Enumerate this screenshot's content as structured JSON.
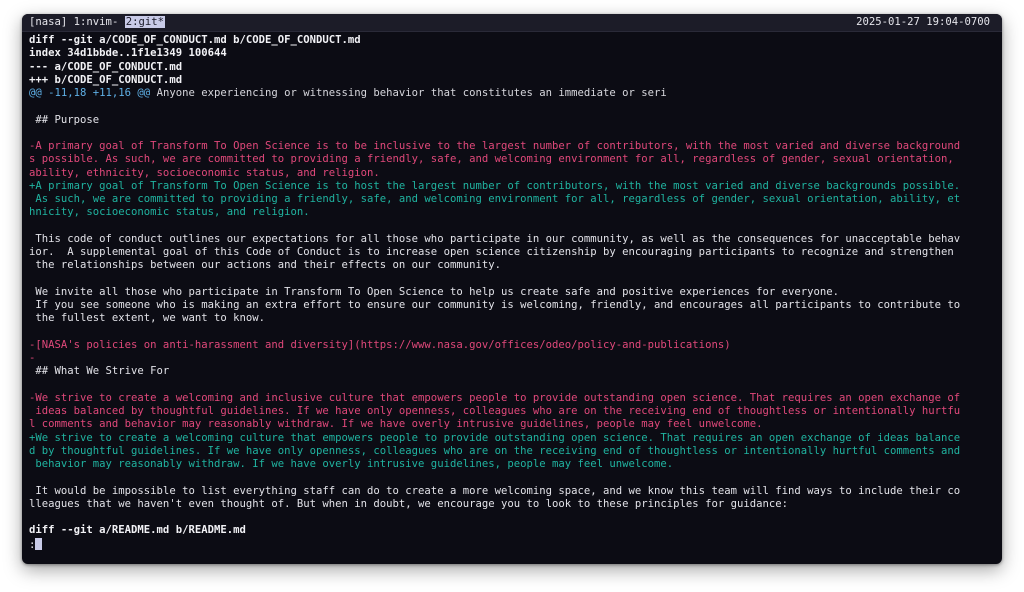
{
  "statusbar": {
    "session": "[nasa]",
    "window1": "1:nvim-",
    "window2": "2:git*",
    "datetime": "2025-01-27 19:04-0700"
  },
  "diff": {
    "lines": [
      {
        "type": "meta",
        "text": "diff --git a/CODE_OF_CONDUCT.md b/CODE_OF_CONDUCT.md"
      },
      {
        "type": "meta",
        "text": "index 34d1bbde..1f1e1349 100644"
      },
      {
        "type": "meta",
        "text": "--- a/CODE_OF_CONDUCT.md"
      },
      {
        "type": "meta",
        "text": "+++ b/CODE_OF_CONDUCT.md"
      },
      {
        "type": "hunk",
        "text": "@@ -11,18 +11,16 @@",
        "rest": " Anyone experiencing or witnessing behavior that constitutes an immediate or seri"
      },
      {
        "type": "ctx",
        "text": ""
      },
      {
        "type": "ctx",
        "text": " ## Purpose"
      },
      {
        "type": "ctx",
        "text": ""
      },
      {
        "type": "del",
        "text": "-A primary goal of Transform To Open Science is to be inclusive to the largest number of contributors, with the most varied and diverse background"
      },
      {
        "type": "del",
        "text": "s possible. As such, we are committed to providing a friendly, safe, and welcoming environment for all, regardless of gender, sexual orientation,"
      },
      {
        "type": "del",
        "text": "ability, ethnicity, socioeconomic status, and religion."
      },
      {
        "type": "add",
        "text": "+A primary goal of Transform To Open Science is to host the largest number of contributors, with the most varied and diverse backgrounds possible."
      },
      {
        "type": "add",
        "text": " As such, we are committed to providing a friendly, safe, and welcoming environment for all, regardless of gender, sexual orientation, ability, et"
      },
      {
        "type": "add",
        "text": "hnicity, socioeconomic status, and religion."
      },
      {
        "type": "ctx",
        "text": ""
      },
      {
        "type": "ctx",
        "text": " This code of conduct outlines our expectations for all those who participate in our community, as well as the consequences for unacceptable behav"
      },
      {
        "type": "ctx",
        "text": "ior.  A supplemental goal of this Code of Conduct is to increase open science citizenship by encouraging participants to recognize and strengthen"
      },
      {
        "type": "ctx",
        "text": " the relationships between our actions and their effects on our community."
      },
      {
        "type": "ctx",
        "text": ""
      },
      {
        "type": "ctx",
        "text": " We invite all those who participate in Transform To Open Science to help us create safe and positive experiences for everyone."
      },
      {
        "type": "ctx",
        "text": " If you see someone who is making an extra effort to ensure our community is welcoming, friendly, and encourages all participants to contribute to"
      },
      {
        "type": "ctx",
        "text": " the fullest extent, we want to know."
      },
      {
        "type": "ctx",
        "text": ""
      },
      {
        "type": "del",
        "text": "-[NASA's policies on anti-harassment and diversity](https://www.nasa.gov/offices/odeo/policy-and-publications)"
      },
      {
        "type": "del",
        "text": "-"
      },
      {
        "type": "ctx",
        "text": " ## What We Strive For"
      },
      {
        "type": "ctx",
        "text": ""
      },
      {
        "type": "del",
        "text": "-We strive to create a welcoming and inclusive culture that empowers people to provide outstanding open science. That requires an open exchange of"
      },
      {
        "type": "del",
        "text": " ideas balanced by thoughtful guidelines. If we have only openness, colleagues who are on the receiving end of thoughtless or intentionally hurtfu"
      },
      {
        "type": "del",
        "text": "l comments and behavior may reasonably withdraw. If we have overly intrusive guidelines, people may feel unwelcome."
      },
      {
        "type": "add",
        "text": "+We strive to create a welcoming culture that empowers people to provide outstanding open science. That requires an open exchange of ideas balance"
      },
      {
        "type": "add",
        "text": "d by thoughtful guidelines. If we have only openness, colleagues who are on the receiving end of thoughtless or intentionally hurtful comments and"
      },
      {
        "type": "add",
        "text": " behavior may reasonably withdraw. If we have overly intrusive guidelines, people may feel unwelcome."
      },
      {
        "type": "ctx",
        "text": ""
      },
      {
        "type": "ctx",
        "text": " It would be impossible to list everything staff can do to create a more welcoming space, and we know this team will find ways to include their co"
      },
      {
        "type": "ctx",
        "text": "lleagues that we haven't even thought of. But when in doubt, we encourage you to look to these principles for guidance:"
      },
      {
        "type": "ctx",
        "text": ""
      },
      {
        "type": "meta",
        "text": "diff --git a/README.md b/README.md"
      }
    ]
  },
  "pager": {
    "prompt": ":"
  }
}
